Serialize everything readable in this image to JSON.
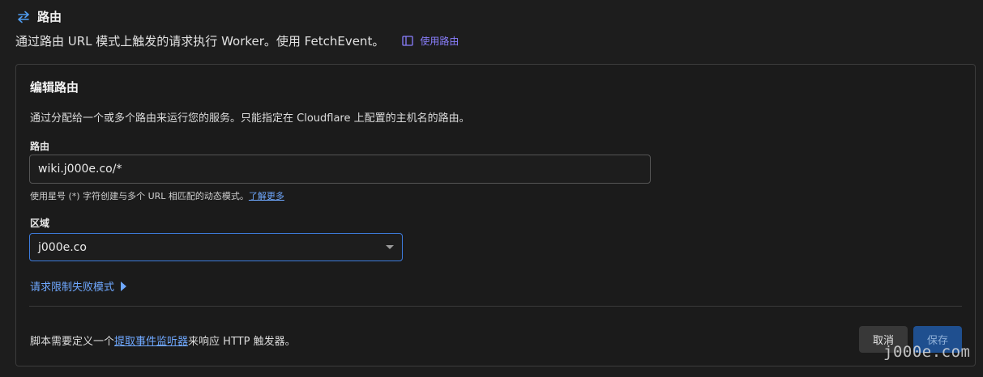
{
  "header": {
    "title": "路由",
    "icon": "swap-arrows-icon"
  },
  "subtitle": {
    "text": "通过路由 URL 模式上触发的请求执行 Worker。使用 FetchEvent。",
    "doc_link_label": "使用路由",
    "doc_link_icon": "book-icon"
  },
  "card": {
    "title": "编辑路由",
    "description": "通过分配给一个或多个路由来运行您的服务。只能指定在 Cloudflare 上配置的主机名的路由。",
    "route": {
      "label": "路由",
      "value": "wiki.j000e.co/*",
      "hint": "使用星号 (*) 字符创建与多个 URL 相匹配的动态模式。",
      "hint_link": "了解更多"
    },
    "zone": {
      "label": "区域",
      "selected": "j000e.co"
    },
    "failure_mode_label": "请求限制失败模式",
    "footer": {
      "prefix": "脚本需要定义一个",
      "link": "提取事件监听器",
      "suffix": "来响应 HTTP 触发器。"
    },
    "buttons": {
      "cancel": "取消",
      "save": "保存"
    }
  },
  "watermark": "j000e.com",
  "colors": {
    "background": "#1d1d1d",
    "accent_link": "#6fa8ff",
    "doc_link": "#8a7fff",
    "focus_border": "#3d7bdc",
    "save_button": "#1f4f8f"
  }
}
